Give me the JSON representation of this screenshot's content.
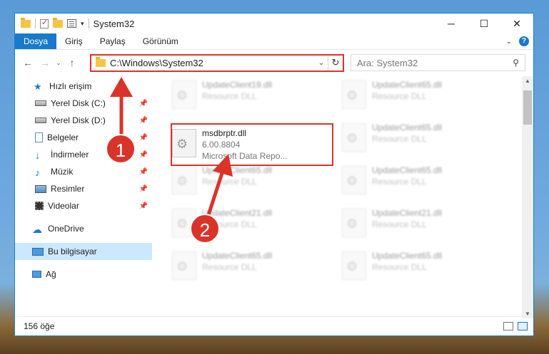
{
  "window": {
    "title": "System32"
  },
  "ribbon": {
    "tabs": [
      "Dosya",
      "Giriş",
      "Paylaş",
      "Görünüm"
    ]
  },
  "address": {
    "path": "C:\\Windows\\System32"
  },
  "search": {
    "placeholder": "Ara: System32"
  },
  "sidebar": {
    "items": [
      {
        "label": "Hızlı erişim"
      },
      {
        "label": "Yerel Disk (C:)"
      },
      {
        "label": "Yerel Disk (D:)"
      },
      {
        "label": "Belgeler"
      },
      {
        "label": "İndirmeler"
      },
      {
        "label": "Müzik"
      },
      {
        "label": "Resimler"
      },
      {
        "label": "Videolar"
      },
      {
        "label": "OneDrive"
      },
      {
        "label": "Bu bilgisayar"
      },
      {
        "label": "Ağ"
      }
    ]
  },
  "files": {
    "highlighted": {
      "name": "msdbrptr.dll",
      "version": "6.00.8804",
      "description": "Microsoft Data Repo..."
    },
    "others": [
      {
        "name": "UpdateClient19.dll",
        "type": "Resource DLL"
      },
      {
        "name": "UpdateClient65.dll",
        "type": "Resource DLL"
      },
      {
        "name": "UpdateClient65.dll",
        "type": "Resource DLL"
      },
      {
        "name": "UpdateClient65.dll",
        "type": "Resource DLL"
      },
      {
        "name": "UpdateClient65.dll",
        "type": "Resource DLL"
      },
      {
        "name": "UpdateClient21.dll",
        "type": "Resource DLL"
      },
      {
        "name": "UpdateClient21.dll",
        "type": "Resource DLL"
      },
      {
        "name": "UpdateClient65.dll",
        "type": "Resource DLL"
      },
      {
        "name": "UpdateClient65.dll",
        "type": "Resource DLL"
      }
    ]
  },
  "status": {
    "count": "156 öğe"
  },
  "callouts": {
    "one": "1",
    "two": "2"
  },
  "colors": {
    "accent": "#1979ca",
    "highlight": "#d9342b"
  }
}
